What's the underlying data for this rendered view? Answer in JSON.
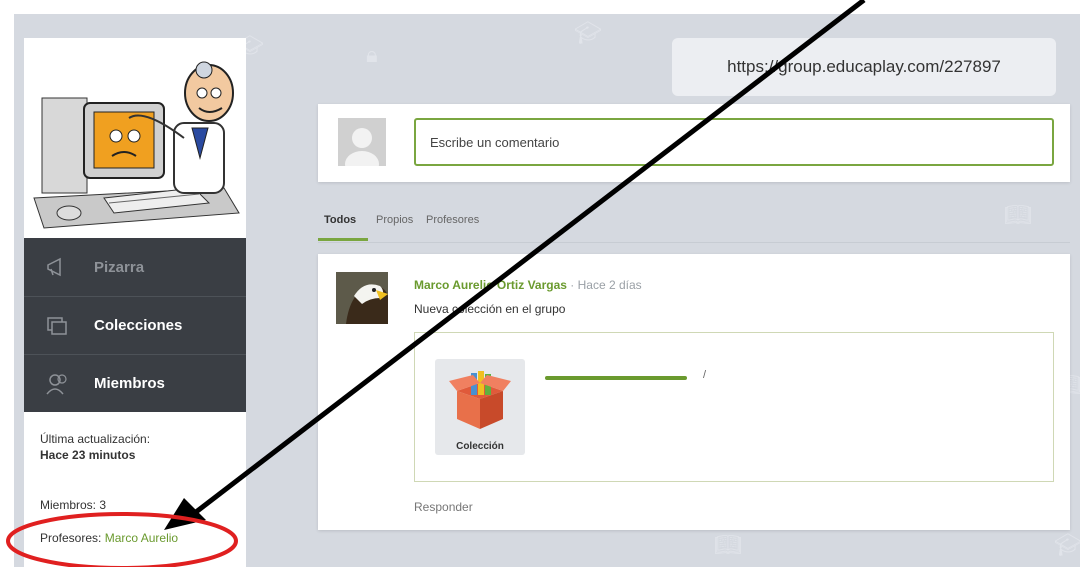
{
  "url_box": {
    "text": "https://group.educaplay.com/227897"
  },
  "sidebar": {
    "nav": [
      {
        "label": "Pizarra",
        "icon": "megaphone-icon"
      },
      {
        "label": "Colecciones",
        "icon": "collections-icon"
      },
      {
        "label": "Miembros",
        "icon": "members-icon"
      }
    ],
    "last_update_label": "Última actualización:",
    "last_update_value": "Hace 23 minutos",
    "members": "Miembros: 3",
    "teachers_label": "Profesores:",
    "teachers_value": "Marco Aurelio"
  },
  "comment": {
    "placeholder": "Escribe un comentario"
  },
  "tabs": [
    {
      "label": "Todos",
      "active": true
    },
    {
      "label": "Propios",
      "active": false
    },
    {
      "label": "Profesores",
      "active": false
    }
  ],
  "post": {
    "author": "Marco Aurelio Ortiz Vargas",
    "separator": "·",
    "time": "Hace 2 días",
    "message": "Nueva colección en el grupo",
    "collection_label": "Colección",
    "progress": 1.0,
    "slash": "/",
    "reply": "Responder"
  },
  "colors": {
    "accent_green": "#7aa640",
    "nav_bg": "#3a3e44",
    "annotation_red": "#e02020"
  }
}
